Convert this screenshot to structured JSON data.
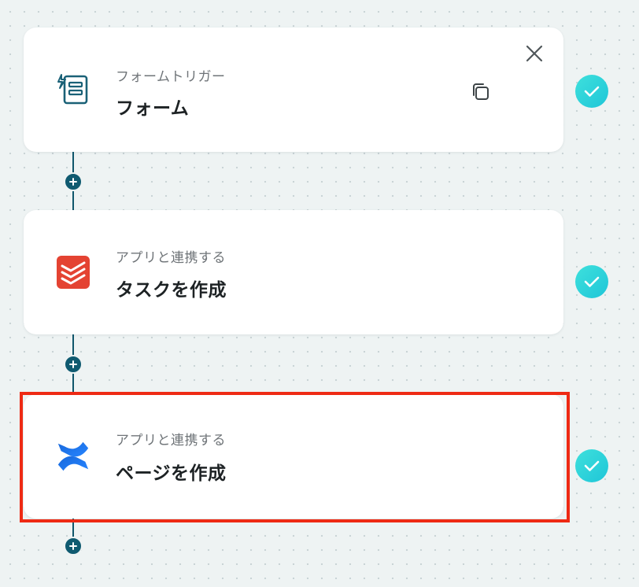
{
  "flow": {
    "steps": [
      {
        "subtitle": "フォームトリガー",
        "title": "フォーム",
        "icon": "form-trigger-icon",
        "status": "completed"
      },
      {
        "subtitle": "アプリと連携する",
        "title": "タスクを作成",
        "icon": "todoist-icon",
        "status": "completed"
      },
      {
        "subtitle": "アプリと連携する",
        "title": "ページを作成",
        "icon": "confluence-icon",
        "status": "completed"
      }
    ]
  },
  "colors": {
    "connector": "#10566b",
    "check_gradient_start": "#3ee0dc",
    "check_gradient_end": "#1fc6d8",
    "highlight": "#ee2a14",
    "todoist": "#e44332",
    "confluence": "#1868db"
  }
}
